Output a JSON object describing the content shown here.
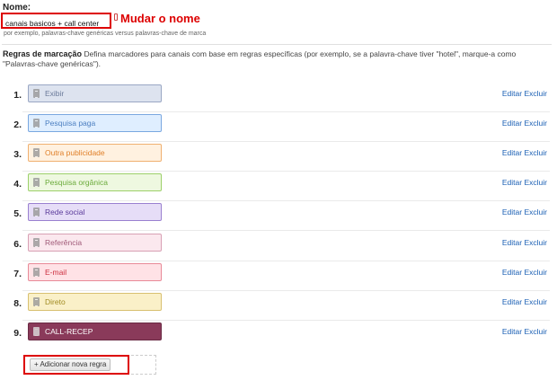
{
  "name": {
    "label": "Nome:",
    "value": "canais basicos + call center",
    "help": "por exemplo, palavras-chave genéricas versus palavras-chave de marca"
  },
  "annotation": {
    "rename": "Mudar o nome"
  },
  "rules": {
    "title": "Regras de marcação",
    "description": "Defina marcadores para canais com base em regras específicas (por exemplo, se a palavra-chave tiver \"hotel\", marque-a como \"Palavras-chave genéricas\").",
    "edit_label": "Editar",
    "delete_label": "Excluir",
    "items": [
      {
        "num": "1.",
        "label": "Exibir",
        "bg": "#dde3ef",
        "border": "#9aa7c4",
        "text": "#6a7a9a"
      },
      {
        "num": "2.",
        "label": "Pesquisa paga",
        "bg": "#dfeeff",
        "border": "#7aa8e0",
        "text": "#4c7fc0"
      },
      {
        "num": "3.",
        "label": "Outra publicidade",
        "bg": "#fff1e0",
        "border": "#f0b070",
        "text": "#e0802a"
      },
      {
        "num": "4.",
        "label": "Pesquisa orgânica",
        "bg": "#eef8e0",
        "border": "#9cd06a",
        "text": "#6aaa3a"
      },
      {
        "num": "5.",
        "label": "Rede social",
        "bg": "#e6ddf7",
        "border": "#9a80d0",
        "text": "#5a3a9a"
      },
      {
        "num": "6.",
        "label": "Referência",
        "bg": "#fbe8ee",
        "border": "#d8a0b4",
        "text": "#a05a78"
      },
      {
        "num": "7.",
        "label": "E-mail",
        "bg": "#ffe2e6",
        "border": "#e88a98",
        "text": "#cc3040"
      },
      {
        "num": "8.",
        "label": "Direto",
        "bg": "#faf0c8",
        "border": "#d8c070",
        "text": "#a08a20"
      },
      {
        "num": "9.",
        "label": "CALL-RECEP",
        "bg": "#8a3a5a",
        "border": "#6a2a44",
        "text": "#ffffff"
      }
    ],
    "add_button": "+ Adicionar nova regra"
  }
}
